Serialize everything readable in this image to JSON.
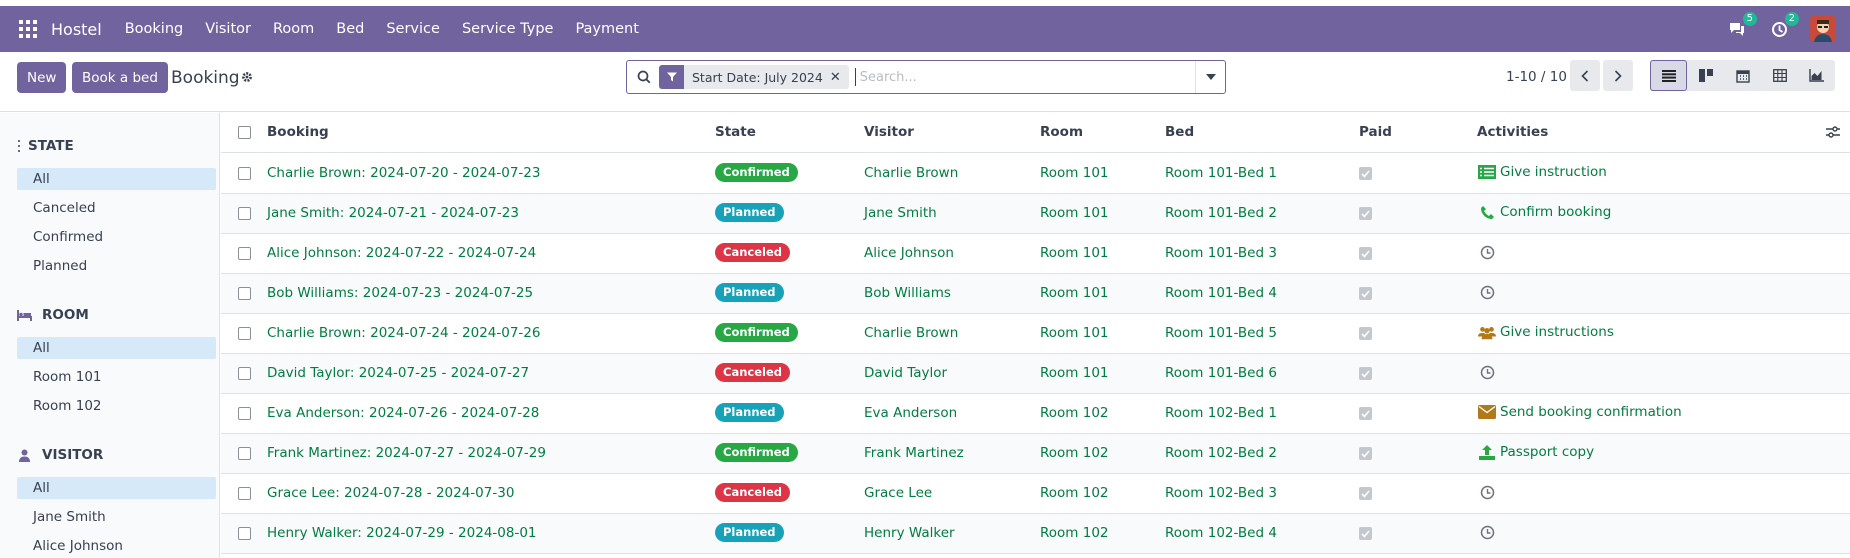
{
  "app": {
    "brand": "Hostel",
    "menu": [
      "Booking",
      "Visitor",
      "Room",
      "Bed",
      "Service",
      "Service Type",
      "Payment"
    ],
    "messages_count": "5",
    "activities_count": "2",
    "colors": {
      "navbar": "#71639e",
      "green_link": "#017e3f",
      "confirmed": "#28a745",
      "planned": "#17a2b8",
      "canceled": "#dc3545"
    }
  },
  "control": {
    "new_label": "New",
    "book_label": "Book a bed",
    "title": "Booking",
    "facet_label": "Start Date: July 2024",
    "search_placeholder": "Search...",
    "pager": "1-10 / 10"
  },
  "sidebar": {
    "state": {
      "title": "STATE",
      "items": [
        "All",
        "Canceled",
        "Confirmed",
        "Planned"
      ]
    },
    "room": {
      "title": "ROOM",
      "items": [
        "All",
        "Room 101",
        "Room 102"
      ]
    },
    "visitor": {
      "title": "VISITOR",
      "items": [
        "All",
        "Jane Smith",
        "Alice Johnson"
      ]
    }
  },
  "table": {
    "headers": {
      "booking": "Booking",
      "state": "State",
      "visitor": "Visitor",
      "room": "Room",
      "bed": "Bed",
      "paid": "Paid",
      "activities": "Activities"
    },
    "rows": [
      {
        "booking": "Charlie Brown: 2024-07-20 - 2024-07-23",
        "state": "Confirmed",
        "visitor": "Charlie Brown",
        "room": "Room 101",
        "bed": "Room 101-Bed 1",
        "paid": true,
        "activity": "Give instruction",
        "activity_icon": "list-icon"
      },
      {
        "booking": "Jane Smith: 2024-07-21 - 2024-07-23",
        "state": "Planned",
        "visitor": "Jane Smith",
        "room": "Room 101",
        "bed": "Room 101-Bed 2",
        "paid": true,
        "activity": "Confirm booking",
        "activity_icon": "phone-icon"
      },
      {
        "booking": "Alice Johnson: 2024-07-22 - 2024-07-24",
        "state": "Canceled",
        "visitor": "Alice Johnson",
        "room": "Room 101",
        "bed": "Room 101-Bed 3",
        "paid": true,
        "activity": "",
        "activity_icon": "clock-icon"
      },
      {
        "booking": "Bob Williams: 2024-07-23 - 2024-07-25",
        "state": "Planned",
        "visitor": "Bob Williams",
        "room": "Room 101",
        "bed": "Room 101-Bed 4",
        "paid": true,
        "activity": "",
        "activity_icon": "clock-icon"
      },
      {
        "booking": "Charlie Brown: 2024-07-24 - 2024-07-26",
        "state": "Confirmed",
        "visitor": "Charlie Brown",
        "room": "Room 101",
        "bed": "Room 101-Bed 5",
        "paid": true,
        "activity": "Give instructions",
        "activity_icon": "users-icon"
      },
      {
        "booking": "David Taylor: 2024-07-25 - 2024-07-27",
        "state": "Canceled",
        "visitor": "David Taylor",
        "room": "Room 101",
        "bed": "Room 101-Bed 6",
        "paid": true,
        "activity": "",
        "activity_icon": "clock-icon"
      },
      {
        "booking": "Eva Anderson: 2024-07-26 - 2024-07-28",
        "state": "Planned",
        "visitor": "Eva Anderson",
        "room": "Room 102",
        "bed": "Room 102-Bed 1",
        "paid": true,
        "activity": "Send booking confirmation",
        "activity_icon": "envelope-icon"
      },
      {
        "booking": "Frank Martinez: 2024-07-27 - 2024-07-29",
        "state": "Confirmed",
        "visitor": "Frank Martinez",
        "room": "Room 102",
        "bed": "Room 102-Bed 2",
        "paid": true,
        "activity": "Passport copy",
        "activity_icon": "upload-icon"
      },
      {
        "booking": "Grace Lee: 2024-07-28 - 2024-07-30",
        "state": "Canceled",
        "visitor": "Grace Lee",
        "room": "Room 102",
        "bed": "Room 102-Bed 3",
        "paid": true,
        "activity": "",
        "activity_icon": "clock-icon"
      },
      {
        "booking": "Henry Walker: 2024-07-29 - 2024-08-01",
        "state": "Planned",
        "visitor": "Henry Walker",
        "room": "Room 102",
        "bed": "Room 102-Bed 4",
        "paid": true,
        "activity": "",
        "activity_icon": "clock-icon"
      }
    ]
  }
}
